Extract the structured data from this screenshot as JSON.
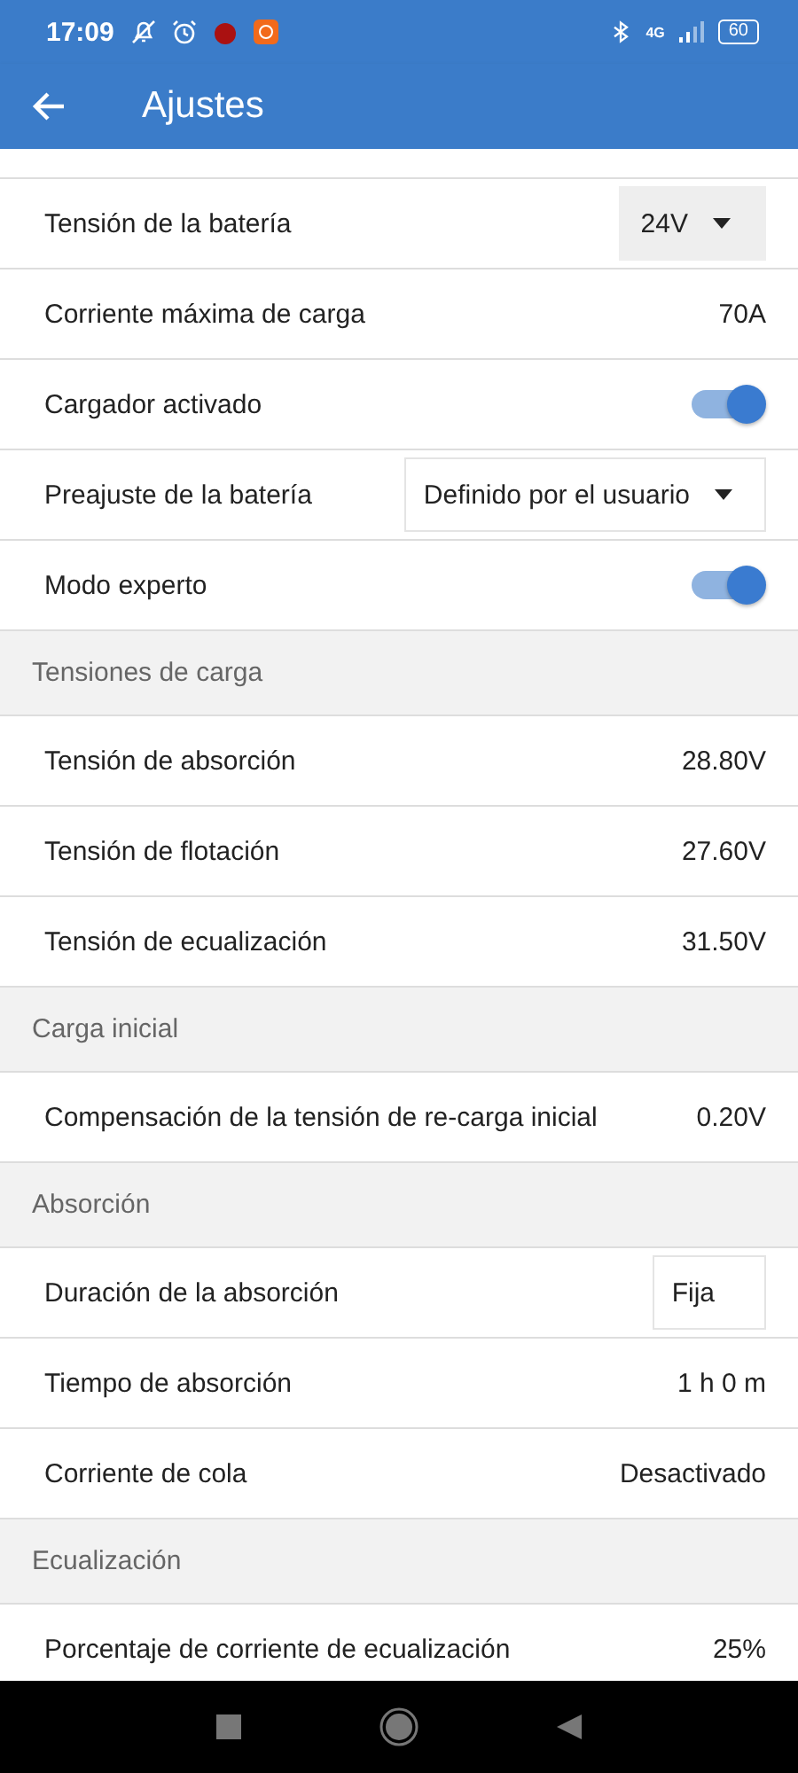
{
  "status_bar": {
    "time": "17:09",
    "network": "4G",
    "battery": "60"
  },
  "app_bar": {
    "title": "Ajustes"
  },
  "sections": [
    {
      "rows": [
        {
          "kind": "dropdown",
          "label": "Tensión de la batería",
          "value": "24V"
        },
        {
          "kind": "value",
          "label": "Corriente máxima de carga",
          "value": "70A"
        },
        {
          "kind": "toggle",
          "label": "Cargador activado",
          "on": true
        },
        {
          "kind": "dropdown",
          "label": "Preajuste de la batería",
          "value": "Definido por el usuario"
        },
        {
          "kind": "toggle",
          "label": "Modo experto",
          "on": true
        }
      ]
    },
    {
      "header": "Tensiones de carga",
      "rows": [
        {
          "kind": "value",
          "label": "Tensión de absorción",
          "value": "28.80V"
        },
        {
          "kind": "value",
          "label": "Tensión de flotación",
          "value": "27.60V"
        },
        {
          "kind": "value",
          "label": "Tensión de ecualización",
          "value": "31.50V"
        }
      ]
    },
    {
      "header": "Carga inicial",
      "rows": [
        {
          "kind": "value",
          "label": "Compensación de la tensión de re-carga inicial",
          "value": "0.20V"
        }
      ]
    },
    {
      "header": "Absorción",
      "rows": [
        {
          "kind": "field",
          "label": "Duración de la absorción",
          "value": "Fija"
        },
        {
          "kind": "value",
          "label": "Tiempo de absorción",
          "value": "1 h 0 m"
        },
        {
          "kind": "value",
          "label": "Corriente de cola",
          "value": "Desactivado"
        }
      ]
    },
    {
      "header": "Ecualización",
      "rows": [
        {
          "kind": "value",
          "label": "Porcentaje de corriente de ecualización",
          "value": "25%"
        }
      ]
    }
  ]
}
